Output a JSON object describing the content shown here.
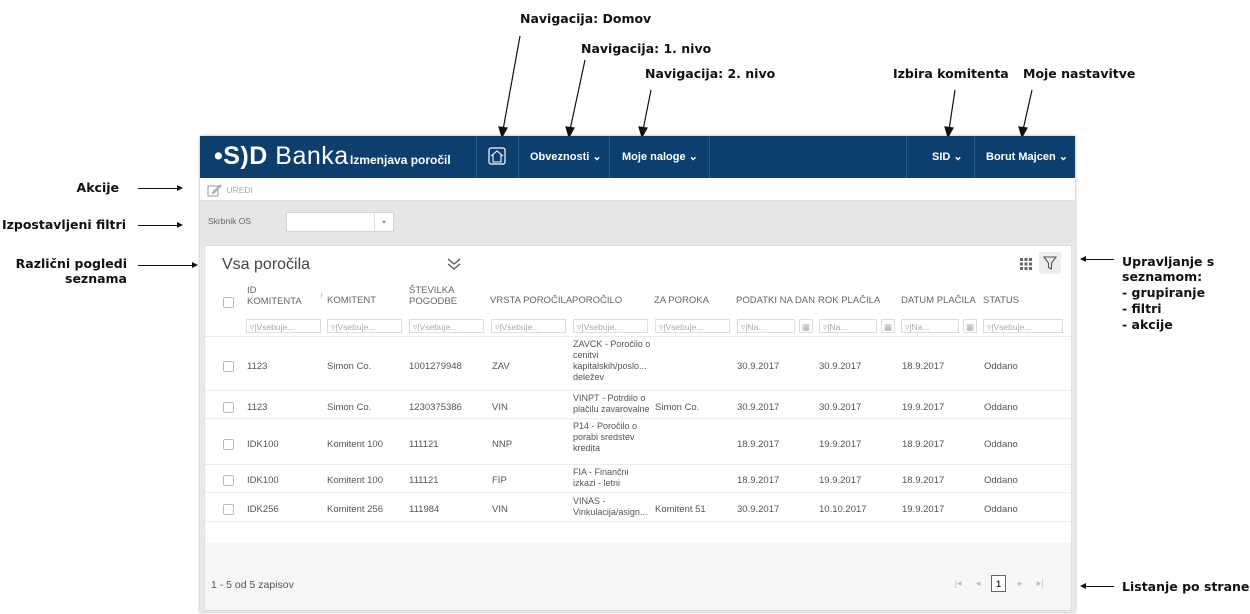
{
  "annotations": {
    "nav_home": "Navigacija: Domov",
    "nav_level1": "Navigacija: 1. nivo",
    "nav_level2": "Navigacija: 2. nivo",
    "client_select": "Izbira komitenta",
    "my_settings": "Moje nastavitve",
    "actions": "Akcije",
    "exposed_filters": "Izpostavljeni filtri",
    "views_line1": "Različni pogledi",
    "views_line2": "seznama",
    "list_mgmt_line1": "Upravljanje s",
    "list_mgmt_line2": "seznamom:",
    "list_mgmt_line3": "- grupiranje",
    "list_mgmt_line4": "- filtri",
    "list_mgmt_line5": "- akcije",
    "paging": "Listanje po straneh"
  },
  "topbar": {
    "brand_prefix": "•S)D",
    "brand_name": "Banka",
    "app_title": "Izmenjava poročil",
    "nav_items": [
      "Obveznosti ⌄",
      "Moje naloge ⌄"
    ],
    "client": "SID ⌄",
    "user": "Borut Majcen ⌄",
    "colors": {
      "bar": "#0d3f6e"
    }
  },
  "toolbar": {
    "edit_label": "UREDI"
  },
  "filters": {
    "owner_label": "Skrbnik OS",
    "owner_value": ""
  },
  "list": {
    "view_title": "Vsa poročila",
    "columns": [
      "ID KOMITENTA",
      "KOMITENT",
      "ŠTEVILKA POGODBE",
      "VRSTA POROČILA",
      "POROČILO",
      "ZA POROKA",
      "PODATKI NA DAN",
      "ROK PLAČILA",
      "DATUM PLAČILA",
      "STATUS"
    ],
    "filter_placeholders": [
      "Vsebuje...",
      "Vsebuje...",
      "Vsebuje...",
      "Vsebuje...",
      "Vsebuje...",
      "Vsebuje...",
      "Na...",
      "Na...",
      "Na...",
      "Vsebuje..."
    ],
    "rows": [
      {
        "id": "1123",
        "client": "Simon Co.",
        "contract": "1001279948",
        "type": "ZAV",
        "report": "ZAVCK - Poročilo o cenitvi kapitalskih/poslo... deležev",
        "guarantor": "",
        "data_date": "30.9.2017",
        "due": "30.9.2017",
        "paid": "18.9.2017",
        "status": "Oddano"
      },
      {
        "id": "1123",
        "client": "Simon Co.",
        "contract": "1230375386",
        "type": "VIN",
        "report": "VINPT - Potrdilo o plačilu zavarovalne",
        "guarantor": "Simon Co.",
        "data_date": "30.9.2017",
        "due": "30.9.2017",
        "paid": "19.9.2017",
        "status": "Oddano"
      },
      {
        "id": "IDK100",
        "client": "Komitent 100",
        "contract": "111121",
        "type": "NNP",
        "report": "P14 - Poročilo o porabi sredstev kredita",
        "guarantor": "",
        "data_date": "18.9.2017",
        "due": "19.9.2017",
        "paid": "18.9.2017",
        "status": "Oddano"
      },
      {
        "id": "IDK100",
        "client": "Komitent 100",
        "contract": "111121",
        "type": "FIP",
        "report": "FIA - Finančni izkazi - letni",
        "guarantor": "",
        "data_date": "18.9.2017",
        "due": "19.9.2017",
        "paid": "18.9.2017",
        "status": "Oddano"
      },
      {
        "id": "IDK256",
        "client": "Komitent 256",
        "contract": "111984",
        "type": "VIN",
        "report": "VINAS - Vinkulacija/asign...",
        "guarantor": "Komitent 51",
        "data_date": "30.9.2017",
        "due": "10.10.2017",
        "paid": "19.9.2017",
        "status": "Oddano"
      }
    ],
    "footer_count": "1 - 5 od 5 zapisov",
    "current_page": "1"
  }
}
